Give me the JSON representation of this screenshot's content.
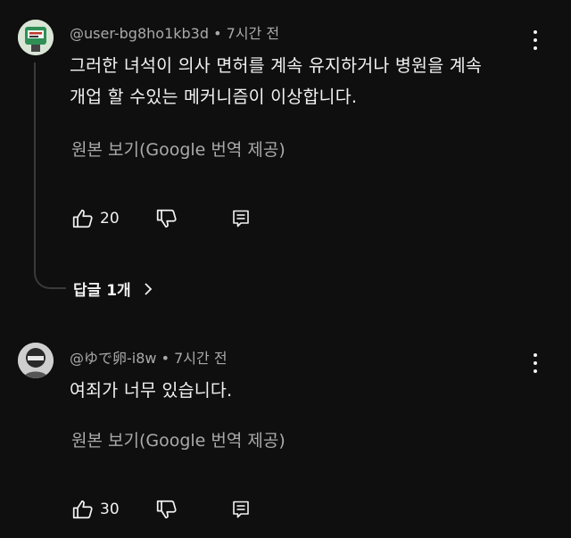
{
  "comments": [
    {
      "author": "@user-bg8ho1kb3d",
      "time": "• 7시간 전",
      "text_line1": "그러한 녀석이 의사 면허를 계속 유지하거나 병원을 계속",
      "text_line2": "개업 할 수있는 메커니즘이 이상합니다.",
      "translate_label": "원본 보기(Google 번역 제공)",
      "likes": "20",
      "replies_label": "답글 1개",
      "avatar_colors": {
        "bg": "#e8f0e6",
        "accent": "#2f8f55",
        "text": "#c0392b"
      }
    },
    {
      "author": "@ゆで卵-i8w",
      "time": "• 7시간 전",
      "text_line1": "여죄가 너무 있습니다.",
      "translate_label": "원본 보기(Google 번역 제공)",
      "likes": "30"
    }
  ]
}
